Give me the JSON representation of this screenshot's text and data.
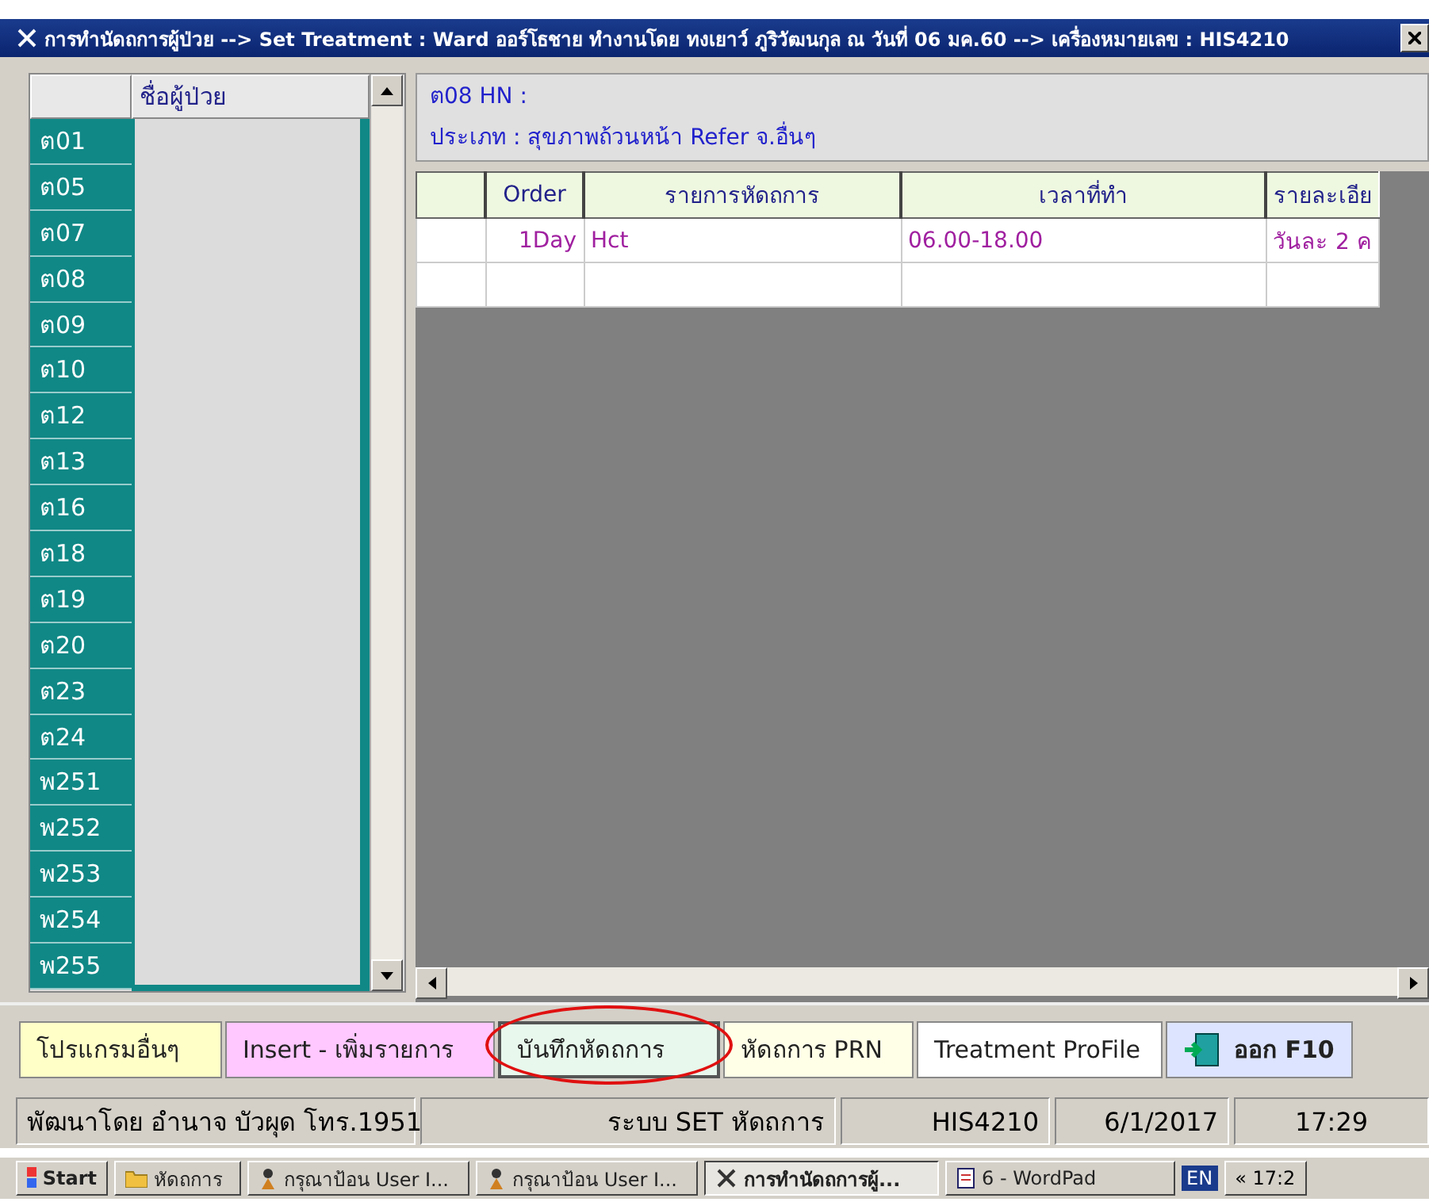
{
  "window": {
    "title": "การทำนัดถการผู้ป่วย --> Set Treatment  : Ward  ออร์โธชาย ทำงานโดย ทงเยาว์ ภูริวัฒนกุล   ณ วันที่ 06 มค.60  --> เครื่องหมายเลข : HIS4210"
  },
  "patient_list": {
    "column_2": "ชื่อผู้ป่วย",
    "beds": [
      "ต01",
      "ต05",
      "ต07",
      "ต08",
      "ต09",
      "ต10",
      "ต12",
      "ต13",
      "ต16",
      "ต18",
      "ต19",
      "ต20",
      "ต23",
      "ต24",
      "พ251",
      "พ252",
      "พ253",
      "พ254",
      "พ255"
    ]
  },
  "patient_info": {
    "bed_hn": "ต08  HN :",
    "type": "ประเภท : สุขภาพถ้วนหน้า Refer จ.อื่นๆ"
  },
  "table": {
    "columns": [
      "Order",
      "รายการหัดถการ",
      "เวลาที่ทำ",
      "รายละเอีย"
    ],
    "rows": [
      [
        "1Day",
        "Hct",
        "06.00-18.00",
        "วันละ 2 ค"
      ]
    ]
  },
  "buttons": [
    {
      "label": "โปรแกรมอื่นๆ",
      "color": "#ffffc8",
      "kind": "text",
      "circled": false
    },
    {
      "label": "Insert - เพิ่มรายการ",
      "color": "#ffc8ff",
      "kind": "text",
      "circled": false
    },
    {
      "label": "บันทึกหัดถการ",
      "color": "#e8f8ec",
      "kind": "text",
      "circled": true
    },
    {
      "label": "หัดถการ PRN",
      "color": "#ffffe8",
      "kind": "text",
      "circled": false
    },
    {
      "label": "Treatment ProFile",
      "color": "#ffffff",
      "kind": "text",
      "circled": false
    },
    {
      "label": "ออก F10",
      "color": "#dde4ff",
      "kind": "exit",
      "circled": false
    }
  ],
  "status_bar": [
    "พัฒนาโดย  อำนาจ  บัวผุด โทร.1951",
    "ระบบ SET หัดถการ",
    "HIS4210",
    "6/1/2017",
    "17:29"
  ],
  "taskbar": {
    "start": "Start",
    "items": [
      {
        "label": "หัดถการ",
        "kind": "folder",
        "selected": false
      },
      {
        "label": "กรุณาป้อน User I...",
        "kind": "app",
        "selected": false
      },
      {
        "label": "กรุณาป้อน User I...",
        "kind": "app",
        "selected": false
      },
      {
        "label": "การทำนัดถการผู้...",
        "kind": "tool",
        "selected": true
      },
      {
        "label": "6 - WordPad",
        "kind": "doc",
        "selected": false
      }
    ],
    "language": "EN",
    "clock": "« 17:2"
  }
}
